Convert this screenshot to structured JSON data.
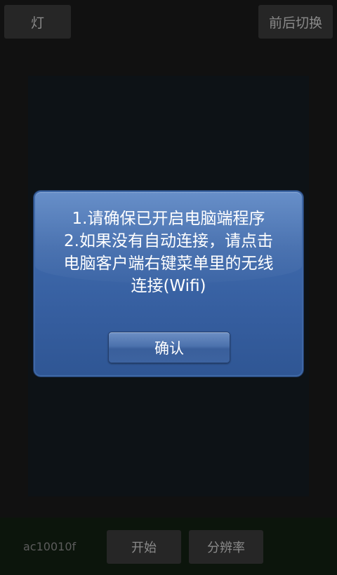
{
  "top_bar": {
    "light_label": "灯",
    "switch_camera_label": "前后切换"
  },
  "bottom_bar": {
    "device_id": "ac10010f",
    "start_label": "开始",
    "resolution_label": "分辨率"
  },
  "dialog": {
    "lines": [
      "1.请确保已开启电脑端程序",
      "2.如果没有自动连接，请点击",
      "电脑客户端右键菜单里的无线",
      "连接(Wifi)"
    ],
    "confirm_label": "确认"
  },
  "colors": {
    "dialog_blue": "#355d9e",
    "button_gray": "#262626",
    "background": "#111111"
  }
}
